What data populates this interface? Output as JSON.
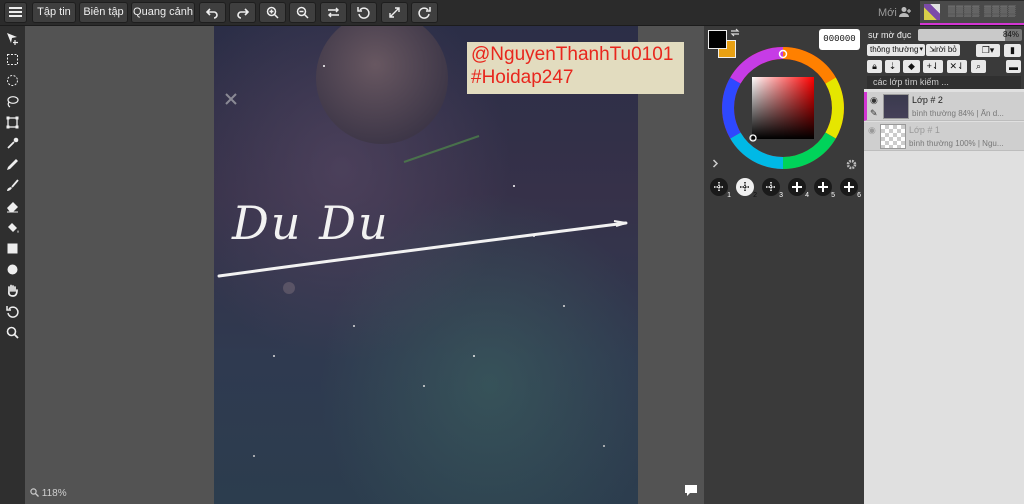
{
  "toolbar": {
    "menu_icon": "hamburger-menu-icon",
    "file_label": "Tập tin",
    "edit_label": "Biên tập",
    "view_label": "Quang cảnh",
    "new_label": "Mới",
    "user_name": "▒▒▒▒ ▒▒▒▒"
  },
  "canvas": {
    "handwriting": "Du Du",
    "watermark_line1": "@NguyenThanhTu0101",
    "watermark_line2": "#Hoidap247",
    "zoom": "118%"
  },
  "color": {
    "hex": "000000",
    "primary": "#000000",
    "secondary": "#e8a013"
  },
  "layers_panel": {
    "opacity_label": "sự mờ đục",
    "opacity_value": "84%",
    "blend_mode": "thông thường",
    "detach_label": "rời bỏ",
    "search_placeholder": "các lớp tìm kiếm ...",
    "layers": [
      {
        "name": "Lớp # 2",
        "desc": "bình thường  84%  |  Ẩn d...",
        "visible": true,
        "selected": true
      },
      {
        "name": "Lớp # 1",
        "desc": "bình thường  100%  |  Ngu...",
        "visible": true,
        "selected": false
      }
    ]
  },
  "brush_presets": [
    "1",
    "2",
    "3",
    "4",
    "5",
    "6"
  ]
}
